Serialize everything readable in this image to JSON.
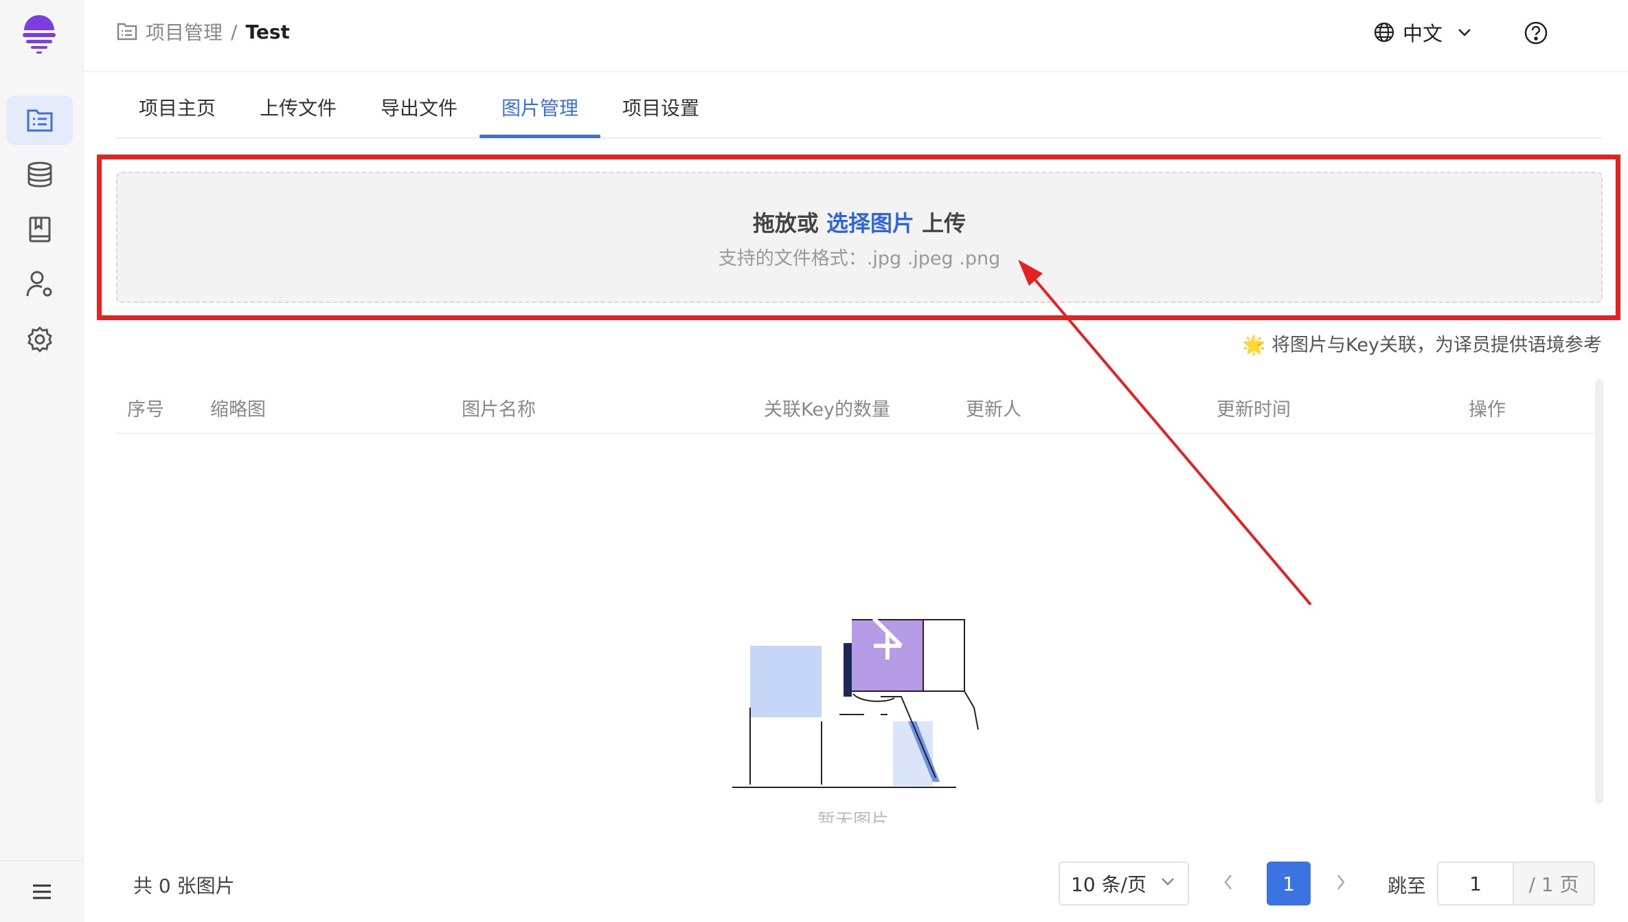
{
  "header": {
    "breadcrumb_parent": "项目管理",
    "breadcrumb_separator": "/",
    "breadcrumb_current": "Test",
    "language": "中文"
  },
  "sidebar": {
    "items": [
      {
        "icon": "project-list-icon",
        "active": true
      },
      {
        "icon": "database-icon",
        "active": false
      },
      {
        "icon": "book-icon",
        "active": false
      },
      {
        "icon": "user-settings-icon",
        "active": false
      },
      {
        "icon": "gear-icon",
        "active": false
      }
    ],
    "bottom_icon": "menu-icon"
  },
  "tabs": [
    {
      "label": "项目主页",
      "active": false
    },
    {
      "label": "上传文件",
      "active": false
    },
    {
      "label": "导出文件",
      "active": false
    },
    {
      "label": "图片管理",
      "active": true
    },
    {
      "label": "项目设置",
      "active": false
    }
  ],
  "dropzone": {
    "prefix": "拖放或",
    "link": "选择图片",
    "suffix": "上传",
    "formats": "支持的文件格式：.jpg .jpeg .png"
  },
  "tip": "🌟 将图片与Key关联，为译员提供语境参考",
  "table": {
    "columns": [
      "序号",
      "缩略图",
      "图片名称",
      "关联Key的数量",
      "更新人",
      "更新时间",
      "操作"
    ],
    "empty_text": "暂无图片"
  },
  "footer": {
    "total": "共 0 张图片",
    "page_size": "10 条/页",
    "current_page": "1",
    "goto_label": "跳至",
    "goto_value": "1",
    "total_pages": "/ 1 页"
  },
  "colors": {
    "accent": "#3b6fe0",
    "highlight": "#e52222"
  }
}
